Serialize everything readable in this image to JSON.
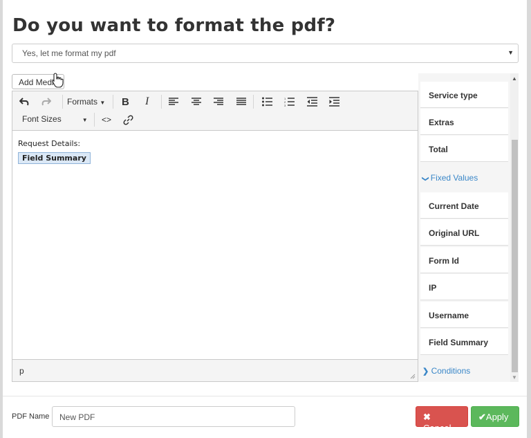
{
  "dialog": {
    "title": "Do you want to format the pdf?",
    "select_value": "Yes, let me format my pdf",
    "add_media_label": "Add Media"
  },
  "toolbar": {
    "formats_label": "Formats",
    "font_sizes_label": "Font Sizes",
    "undo_icon": "undo-icon",
    "redo_icon": "redo-icon"
  },
  "editor": {
    "line1": "Request Details:",
    "tag": "Field Summary",
    "status_path": "p"
  },
  "sidebar": {
    "items_top": [
      "Service type",
      "Extras",
      "Total"
    ],
    "fixed_values_header": "Fixed Values",
    "fixed_items": [
      "Current Date",
      "Original URL",
      "Form Id",
      "IP",
      "Username",
      "Field Summary"
    ],
    "conditions_header": "Conditions"
  },
  "footer": {
    "pdf_name_label": "PDF Name",
    "pdf_name_value": "New PDF",
    "cancel_label": "Cancel",
    "apply_label": "Apply"
  },
  "colors": {
    "cancel": "#d9534f",
    "apply": "#5cb85c",
    "link_blue": "#3a87c8"
  }
}
